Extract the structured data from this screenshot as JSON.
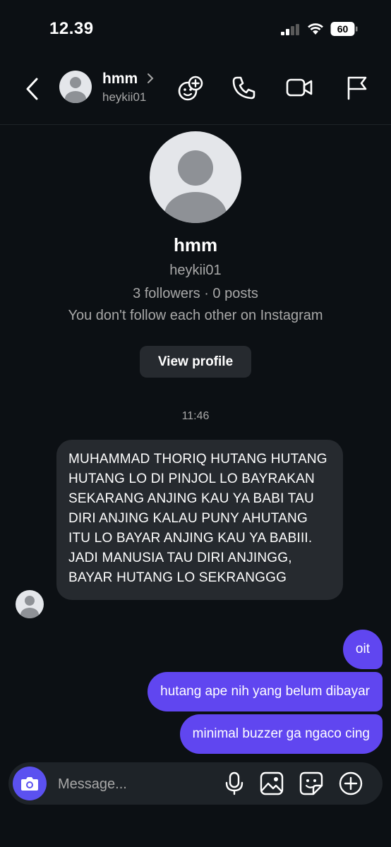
{
  "status": {
    "time": "12.39",
    "battery": "60",
    "icons": [
      "signal-icon",
      "wifi-icon",
      "battery-icon"
    ]
  },
  "header": {
    "name": "hmm",
    "username": "heykii01",
    "icons": [
      "back-icon",
      "chevron-right-icon",
      "add-people-icon",
      "phone-icon",
      "video-icon",
      "flag-icon"
    ]
  },
  "profile": {
    "name": "hmm",
    "username": "heykii01",
    "stats": "3 followers · 0 posts",
    "follow_status": "You don't follow each other on Instagram",
    "view_profile_label": "View profile"
  },
  "chat": {
    "timestamp": "11:46",
    "received": [
      "MUHAMMAD THORIQ HUTANG HUTANG HUTANG LO DI PINJOL LO BAYRAKAN SEKARANG ANJING KAU YA BABI TAU DIRI ANJING KALAU PUNY AHUTANG ITU LO BAYAR ANJING KAU YA BABIII. JADI MANUSIA TAU DIRI ANJINGG, BAYAR HUTANG LO SEKRANGGG"
    ],
    "sent": [
      "oit",
      "hutang ape nih yang belum dibayar",
      "minimal buzzer ga ngaco cing"
    ]
  },
  "composer": {
    "placeholder": "Message...",
    "icons": [
      "camera-icon",
      "microphone-icon",
      "gallery-icon",
      "sticker-icon",
      "add-icon"
    ]
  },
  "colors": {
    "background": "#0c1014",
    "sent_bubble": "#6046f0",
    "received_bubble": "#262a2f",
    "camera_button": "#5b51f0",
    "secondary_text": "#a8a8a8"
  }
}
